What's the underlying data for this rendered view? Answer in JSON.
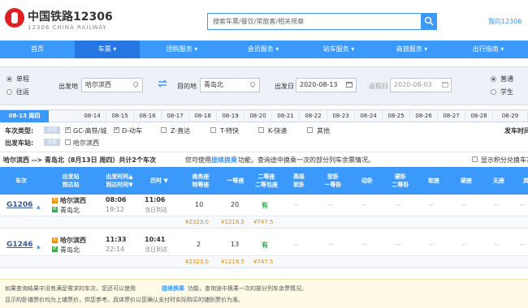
{
  "header": {
    "logo_cn": "中国铁路12306",
    "logo_en": "12306 CHINA RAILWAY",
    "search_placeholder": "搜索车票/餐饮/常旅客/相关规章",
    "my_account": "我的12306"
  },
  "nav": [
    "首页",
    "车票 ▾",
    "团购服务 ▾",
    "会员服务 ▾",
    "站车服务 ▾",
    "商旅服务 ▾",
    "出行指南 ▾"
  ],
  "query": {
    "trip_type": [
      "单程",
      "往返"
    ],
    "from_label": "出发地",
    "from_value": "哈尔滨西",
    "to_label": "目的地",
    "to_value": "青岛北",
    "depart_label": "出发日",
    "depart_value": "2020-08-13",
    "return_label": "返程日",
    "return_value": "2020-08-03",
    "passenger_type": [
      "普通",
      "学生"
    ]
  },
  "dates": [
    "08-13 周四",
    "08-14",
    "08-15",
    "08-16",
    "08-17",
    "08-18",
    "08-19",
    "08-20",
    "08-21",
    "08-22",
    "08-23",
    "08-24",
    "08-25",
    "08-26",
    "08-27",
    "08-28",
    "08-29"
  ],
  "filters": {
    "train_type_label": "车次类型:",
    "all_tag": "全部",
    "types": [
      "GC-高铁/城",
      "D-动车",
      "Z-直达",
      "T-特快",
      "K-快速",
      "其他"
    ],
    "depart_station_label": "出发车站:",
    "stations": [
      "哈尔滨西"
    ],
    "depart_time_label": "发车时间"
  },
  "result": {
    "summary": "哈尔滨西 --> 青岛北（8月13日 周四）共计2个车次",
    "tip_prefix": "您可使用",
    "tip_link": "接续换乘",
    "tip_suffix": "功能，查询途中换乘一次的部分列车余票情况。",
    "points_label": "显示积分兑换车次"
  },
  "table": {
    "headers": [
      "车次",
      "出发站\n到达站",
      "出发时间▲\n到达时间▼",
      "历时 ▼",
      "商务座\n特等座",
      "一等座",
      "二等座\n二等包座",
      "高级\n软卧",
      "软卧\n一等卧",
      "动卧",
      "硬卧\n二等卧",
      "软座",
      "硬座",
      "无座",
      "其他"
    ],
    "rows": [
      {
        "train": "G1206",
        "from": "哈尔滨西",
        "to": "青岛北",
        "dep": "08:06",
        "arr": "19:12",
        "duration": "11:06",
        "arrive_note": "当日到达",
        "business": "10",
        "first": "20",
        "second": "有",
        "rest": [
          "--",
          "--",
          "--",
          "--",
          "--",
          "--",
          "--",
          "--"
        ],
        "prices": [
          "¥2323.0",
          "¥1218.5",
          "¥747.5"
        ]
      },
      {
        "train": "G1246",
        "from": "哈尔滨西",
        "to": "青岛北",
        "dep": "11:33",
        "arr": "22:14",
        "duration": "10:41",
        "arrive_note": "当日到达",
        "business": "2",
        "first": "13",
        "second": "有",
        "rest": [
          "--",
          "--",
          "--",
          "--",
          "--",
          "--",
          "--",
          "--"
        ],
        "prices": [
          "¥2323.0",
          "¥1218.5",
          "¥747.5"
        ]
      }
    ]
  },
  "note": {
    "line1_prefix": "如果查询结果中没有满足需求的车次，您还可以使用",
    "line1_link": "接续换乘",
    "line1_suffix": "功能，查询途中换乘一次的部分列车余票情况。",
    "line2": "显示的卧铺票价均为上铺票价，供您参考。具体票价以您确认支付时实际购买的铺别票价为准。"
  },
  "colors": {
    "brand_blue": "#3b99fc",
    "price_orange": "#e08a00",
    "available_green": "#3aa64a",
    "logo_red": "#e02020"
  }
}
